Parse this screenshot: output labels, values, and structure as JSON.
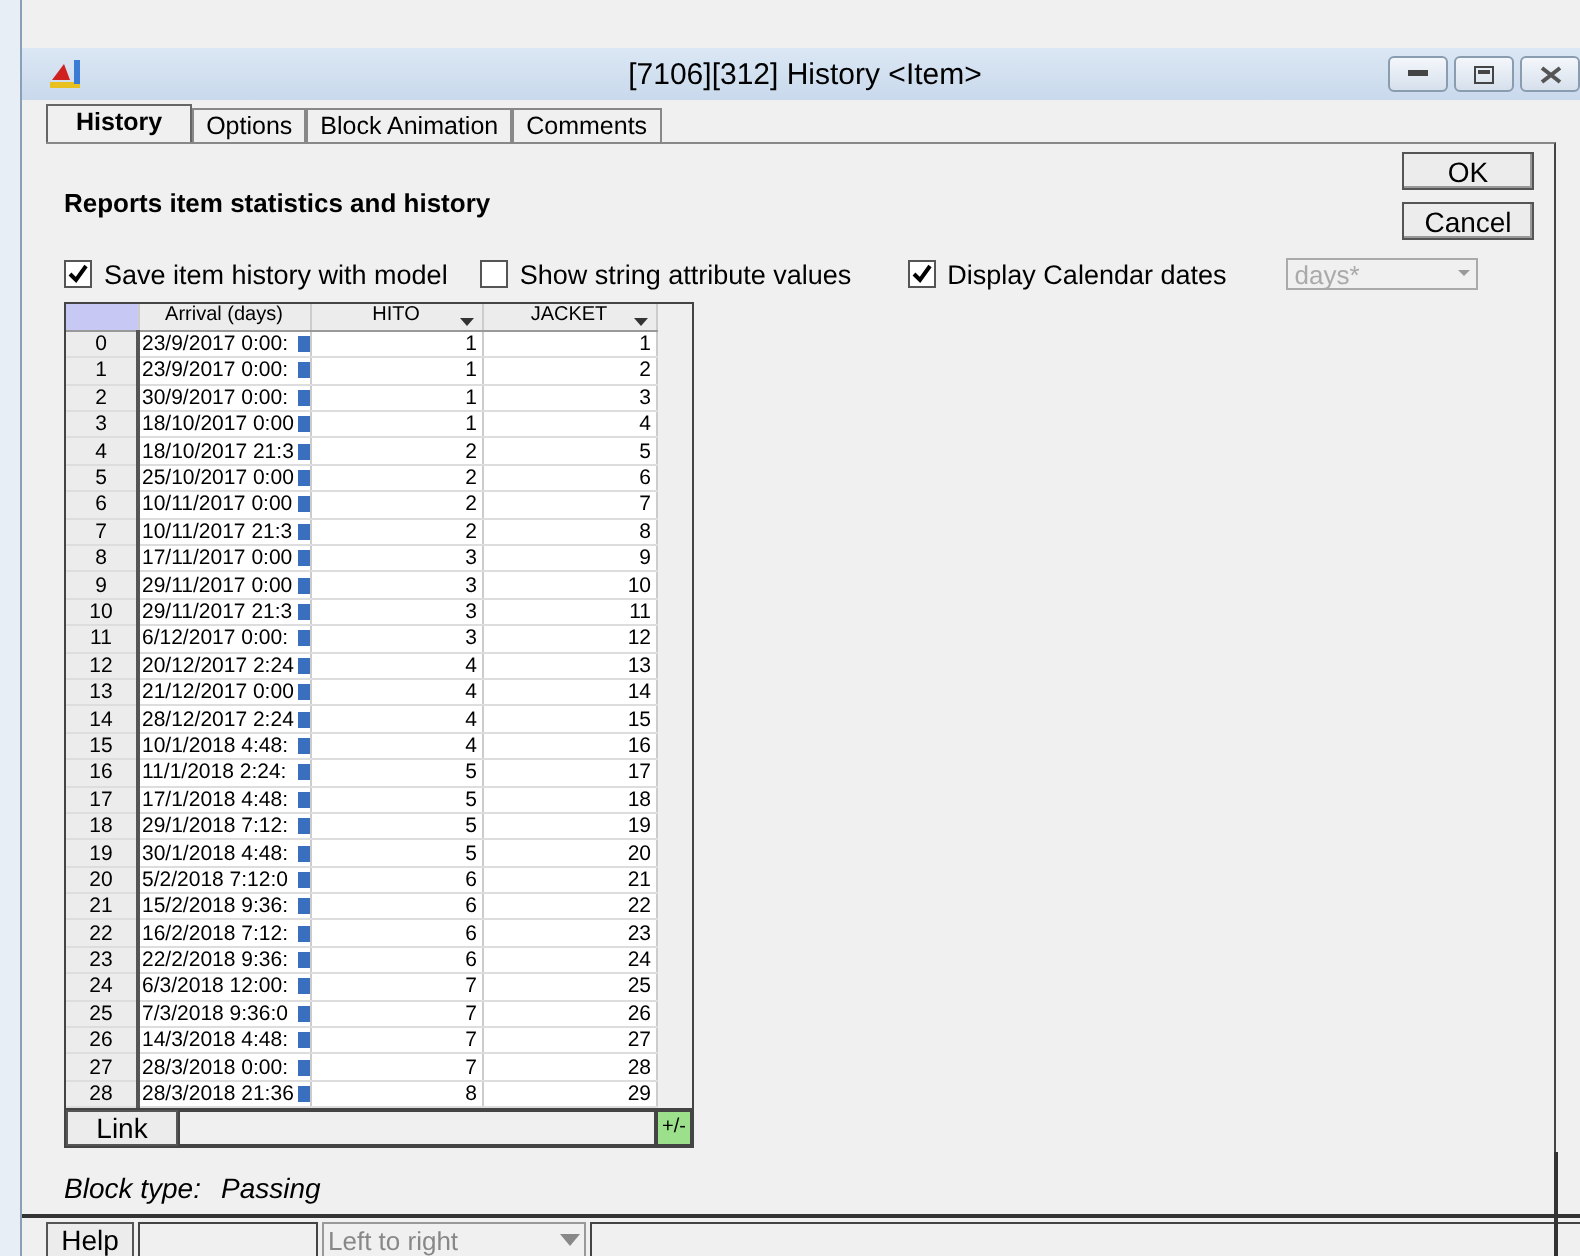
{
  "window": {
    "title": "[7106][312]   History   <Item>"
  },
  "tabs": [
    {
      "label": "History",
      "selected": true
    },
    {
      "label": "Options",
      "selected": false
    },
    {
      "label": "Block Animation",
      "selected": false
    },
    {
      "label": "Comments",
      "selected": false
    }
  ],
  "buttons": [
    "OK",
    "Cancel"
  ],
  "heading": "Reports item statistics and history",
  "options": [
    {
      "label": "Save item history with model",
      "checked": true
    },
    {
      "label": "Show string attribute values",
      "checked": false
    },
    {
      "label": "Display Calendar dates",
      "checked": true
    }
  ],
  "units_dropdown": {
    "value": "days*",
    "disabled": true
  },
  "table": {
    "columns": [
      "",
      "Arrival (days)",
      "HITO",
      "JACKET"
    ],
    "rows": [
      [
        "0",
        "23/9/2017 0:00:",
        "1",
        "1"
      ],
      [
        "1",
        "23/9/2017 0:00:",
        "1",
        "2"
      ],
      [
        "2",
        "30/9/2017 0:00:",
        "1",
        "3"
      ],
      [
        "3",
        "18/10/2017 0:00",
        "1",
        "4"
      ],
      [
        "4",
        "18/10/2017 21:3",
        "2",
        "5"
      ],
      [
        "5",
        "25/10/2017 0:00",
        "2",
        "6"
      ],
      [
        "6",
        "10/11/2017 0:00",
        "2",
        "7"
      ],
      [
        "7",
        "10/11/2017 21:3",
        "2",
        "8"
      ],
      [
        "8",
        "17/11/2017 0:00",
        "3",
        "9"
      ],
      [
        "9",
        "29/11/2017 0:00",
        "3",
        "10"
      ],
      [
        "10",
        "29/11/2017 21:3",
        "3",
        "11"
      ],
      [
        "11",
        "6/12/2017 0:00:",
        "3",
        "12"
      ],
      [
        "12",
        "20/12/2017 2:24",
        "4",
        "13"
      ],
      [
        "13",
        "21/12/2017 0:00",
        "4",
        "14"
      ],
      [
        "14",
        "28/12/2017 2:24",
        "4",
        "15"
      ],
      [
        "15",
        "10/1/2018 4:48:",
        "4",
        "16"
      ],
      [
        "16",
        "11/1/2018 2:24:",
        "5",
        "17"
      ],
      [
        "17",
        "17/1/2018 4:48:",
        "5",
        "18"
      ],
      [
        "18",
        "29/1/2018 7:12:",
        "5",
        "19"
      ],
      [
        "19",
        "30/1/2018 4:48:",
        "5",
        "20"
      ],
      [
        "20",
        "5/2/2018 7:12:0",
        "6",
        "21"
      ],
      [
        "21",
        "15/2/2018 9:36:",
        "6",
        "22"
      ],
      [
        "22",
        "16/2/2018 7:12:",
        "6",
        "23"
      ],
      [
        "23",
        "22/2/2018 9:36:",
        "6",
        "24"
      ],
      [
        "24",
        "6/3/2018 12:00:",
        "7",
        "25"
      ],
      [
        "25",
        "7/3/2018 9:36:0",
        "7",
        "26"
      ],
      [
        "26",
        "14/3/2018 4:48:",
        "7",
        "27"
      ],
      [
        "27",
        "28/3/2018 0:00:",
        "7",
        "28"
      ],
      [
        "28",
        "28/3/2018 21:36",
        "8",
        "29"
      ]
    ],
    "link_button": "Link",
    "plus_minus": "+/-"
  },
  "block_type": {
    "label": "Block type:",
    "value": "Passing"
  },
  "footer": {
    "help": "Help",
    "direction": "Left to right"
  }
}
